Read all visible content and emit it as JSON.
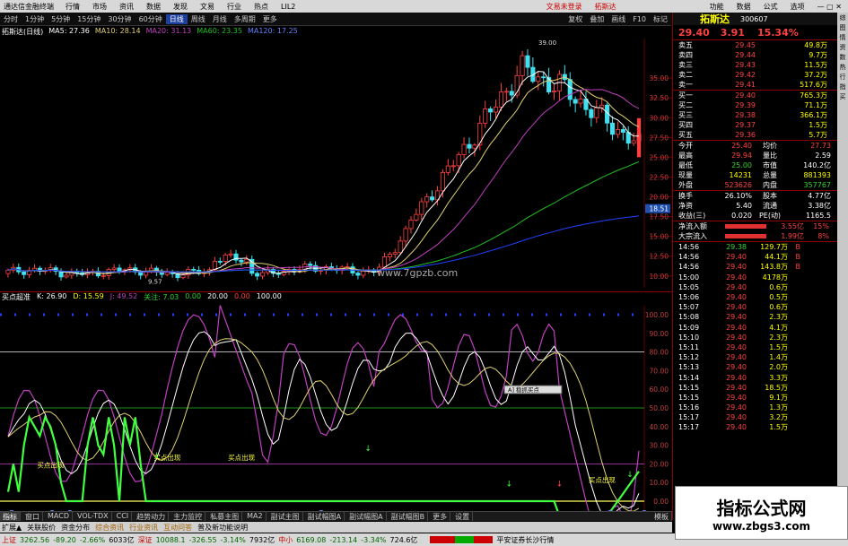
{
  "app_title": "通达信金融终端",
  "menu": [
    "行情",
    "市场",
    "资讯",
    "数据",
    "发现",
    "文易",
    "行业",
    "热点",
    "LIL2"
  ],
  "top_right_links": [
    "文易未登录",
    "拓斯达"
  ],
  "top_right_menu": [
    "功能",
    "数据",
    "公式",
    "选项"
  ],
  "periods": [
    "分时",
    "1分钟",
    "5分钟",
    "15分钟",
    "30分钟",
    "60分钟",
    "日线",
    "周线",
    "月线",
    "多周期",
    "更多"
  ],
  "selected_period": "日线",
  "right_toolbar": [
    "复权",
    "叠加",
    "画线",
    "F10",
    "标记"
  ],
  "ma_line": {
    "name": "拓斯达(日线)",
    "ma5": "MA5: 27.36",
    "ma10": "MA10: 28.14",
    "ma20": "MA20: 31.13",
    "ma60": "MA60: 23.35",
    "ma120": "MA120: 17.25"
  },
  "price_axis": [
    "35.00",
    "32.50",
    "30.00",
    "27.50",
    "25.00",
    "22.50",
    "20.00",
    "17.50",
    "15.00",
    "12.50",
    "10.00"
  ],
  "axis_mark": "18.51",
  "high_label": "39.00",
  "low_label": "9.57",
  "indicator": {
    "name": "买点超准",
    "k": "K: 26.90",
    "d": "D: 15.59",
    "j": "J: 49.52",
    "f": "关注: 7.03",
    "v1": "0.00",
    "v2": "20.00",
    "v3": "0.00",
    "v4": "100.00"
  },
  "ind_axis": [
    "100.00",
    "90.00",
    "80.00",
    "70.00",
    "60.00",
    "50.00",
    "40.00",
    "30.00",
    "20.00",
    "10.00",
    "0.00"
  ],
  "buy_labels": [
    "买点出现",
    "买点出现",
    "买点出现",
    "买点出现"
  ],
  "dialog_label": "A] 稳抓买点",
  "date_axis": {
    "d1": "2024年",
    "d2": "9",
    "d3": "2024/09/30",
    "d4": "11",
    "d5": "12",
    "d6": "1"
  },
  "stock": {
    "name": "拓斯达",
    "code": "300607",
    "price": "29.40",
    "change": "3.91",
    "pct": "15.34%"
  },
  "order_book": [
    {
      "label": "卖五",
      "price": "29.45",
      "vol": "49.8万"
    },
    {
      "label": "卖四",
      "price": "29.44",
      "vol": "9.7万"
    },
    {
      "label": "卖三",
      "price": "29.43",
      "vol": "11.5万"
    },
    {
      "label": "卖二",
      "price": "29.42",
      "vol": "37.2万"
    },
    {
      "label": "卖一",
      "price": "29.41",
      "vol": "517.6万"
    },
    {
      "label": "买一",
      "price": "29.40",
      "vol": "765.3万"
    },
    {
      "label": "买二",
      "price": "29.39",
      "vol": "71.1万"
    },
    {
      "label": "买三",
      "price": "29.38",
      "vol": "366.1万"
    },
    {
      "label": "买四",
      "price": "29.37",
      "vol": "1.5万"
    },
    {
      "label": "买五",
      "price": "29.36",
      "vol": "5.7万"
    }
  ],
  "stats": [
    {
      "l1": "今开",
      "v1": "25.40",
      "l2": "均价",
      "v2": "27.73"
    },
    {
      "l1": "最高",
      "v1": "29.94",
      "l2": "量比",
      "v2": "2.59"
    },
    {
      "l1": "最低",
      "v1": "25.00",
      "l2": "市值",
      "v2": "140.2亿"
    },
    {
      "l1": "现量",
      "v1": "14231",
      "l2": "总量",
      "v2": "881393"
    },
    {
      "l1": "外盘",
      "v1": "523626",
      "l2": "内盘",
      "v2": "357767"
    },
    {
      "l1": "换手",
      "v1": "26.10%",
      "l2": "股本",
      "v2": "4.77亿"
    },
    {
      "l1": "净资",
      "v1": "5.40",
      "l2": "流通",
      "v2": "3.38亿"
    },
    {
      "l1": "收益(三)",
      "v1": "0.020",
      "l2": "PE(动)",
      "v2": "1165.5"
    }
  ],
  "flows": [
    {
      "label": "净流入额",
      "value": "3.55亿",
      "pct": "15%"
    },
    {
      "label": "大宗流入",
      "value": "1.99亿",
      "pct": "8%"
    }
  ],
  "ticks": [
    {
      "t": "14:56",
      "p": "29.38",
      "v": "129.7万",
      "s": "B"
    },
    {
      "t": "14:56",
      "p": "29.40",
      "v": "44.1万",
      "s": "B"
    },
    {
      "t": "14:56",
      "p": "29.40",
      "v": "143.8万",
      "s": "B"
    },
    {
      "t": "15:00",
      "p": "29.40",
      "v": "4178万",
      "s": ""
    },
    {
      "t": "15:05",
      "p": "29.40",
      "v": "0.6万",
      "s": ""
    },
    {
      "t": "15:06",
      "p": "29.40",
      "v": "0.5万",
      "s": ""
    },
    {
      "t": "15:07",
      "p": "29.40",
      "v": "0.6万",
      "s": ""
    },
    {
      "t": "15:08",
      "p": "29.40",
      "v": "2.3万",
      "s": ""
    },
    {
      "t": "15:09",
      "p": "29.40",
      "v": "4.1万",
      "s": ""
    },
    {
      "t": "15:10",
      "p": "29.40",
      "v": "2.3万",
      "s": ""
    },
    {
      "t": "15:11",
      "p": "29.40",
      "v": "1.5万",
      "s": ""
    },
    {
      "t": "15:12",
      "p": "29.40",
      "v": "1.4万",
      "s": ""
    },
    {
      "t": "15:13",
      "p": "29.40",
      "v": "2.0万",
      "s": ""
    },
    {
      "t": "15:14",
      "p": "29.40",
      "v": "3.3万",
      "s": ""
    },
    {
      "t": "15:15",
      "p": "29.40",
      "v": "18.5万",
      "s": ""
    },
    {
      "t": "15:15",
      "p": "29.40",
      "v": "9.1万",
      "s": ""
    },
    {
      "t": "15:16",
      "p": "29.40",
      "v": "1.3万",
      "s": ""
    },
    {
      "t": "15:17",
      "p": "29.40",
      "v": "3.2万",
      "s": ""
    },
    {
      "t": "15:17",
      "p": "29.40",
      "v": "1.5万",
      "s": ""
    }
  ],
  "bottom_tabs": [
    "指标",
    "窗口",
    "MACD",
    "VOL-TDX",
    "CCI",
    "趋势动力",
    "主力监控",
    "私募主图",
    "MA2",
    "副试主图",
    "副试幅图A",
    "副试幅图A",
    "副试幅图B",
    "更多",
    "设置"
  ],
  "bottom_tabs2": [
    "扩展▲",
    "关联股价",
    "资金分布",
    "综合资讯",
    "行业资讯",
    "互动问答",
    "普及新功能说明"
  ],
  "right_bottom": "模板",
  "status": {
    "sh_label": "上证",
    "sh": "3262.56",
    "sh_chg": "-89.20",
    "sh_pct": "-2.66%",
    "sh_amt": "6033亿",
    "sz_label": "深证",
    "sz": "10088.1",
    "sz_chg": "-326.55",
    "sz_pct": "-3.14%",
    "sz_amt": "7932亿",
    "zx_label": "中小",
    "zx": "6169.08",
    "zx_chg": "-213.14",
    "zx_pct": "-3.34%",
    "zx_amt": "724.6亿",
    "broker": "平安证券长沙行情"
  },
  "vertical_tabs": [
    "综",
    "图",
    "情",
    "资",
    "数",
    "热",
    "行",
    "指",
    "买"
  ],
  "watermark": {
    "title": "指标公式网",
    "url": "www.zbgs3.com",
    "mid": "www.7gpzb.com"
  },
  "colors": {
    "up": "#ff4040",
    "down": "#00e0e0",
    "ma5": "#ffffff",
    "ma10": "#e0d070",
    "ma20": "#c040c0",
    "ma60": "#20c020",
    "ma120": "#2040ff"
  }
}
